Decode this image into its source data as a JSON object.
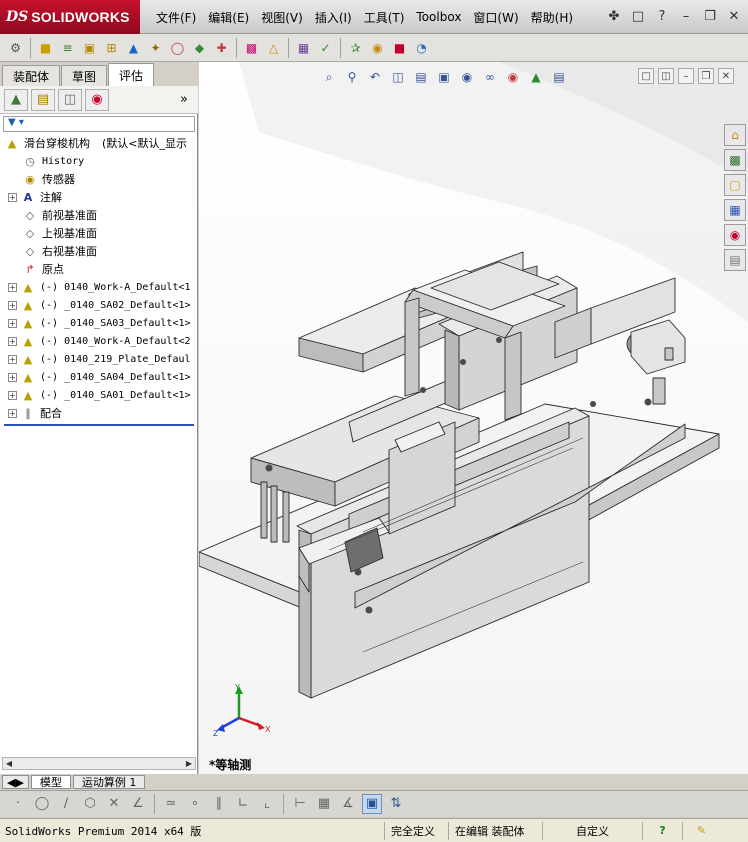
{
  "app": {
    "brand": "SOLIDWORKS",
    "brand_prefix": "DS"
  },
  "menu": [
    "文件(F)",
    "编辑(E)",
    "视图(V)",
    "插入(I)",
    "工具(T)",
    "Toolbox",
    "窗口(W)",
    "帮助(H)"
  ],
  "tabs": {
    "assembly": "装配体",
    "sketch": "草图",
    "evaluate": "评估"
  },
  "tree": {
    "root": "滑台穿梭机构",
    "root_config": "(默认<默认_显示",
    "items": [
      {
        "label": "History",
        "icon": "history-icon",
        "expandable": false
      },
      {
        "label": "传感器",
        "icon": "sensor-icon",
        "expandable": false
      },
      {
        "label": "注解",
        "icon": "annotation-icon",
        "expandable": true
      },
      {
        "label": "前视基准面",
        "icon": "plane-icon",
        "expandable": false
      },
      {
        "label": "上视基准面",
        "icon": "plane-icon",
        "expandable": false
      },
      {
        "label": "右视基准面",
        "icon": "plane-icon",
        "expandable": false
      },
      {
        "label": "原点",
        "icon": "origin-icon",
        "expandable": false
      },
      {
        "label": "(-) 0140_Work-A_Default<1",
        "icon": "subassembly-icon",
        "expandable": true
      },
      {
        "label": "(-) _0140_SA02_Default<1>",
        "icon": "subassembly-icon",
        "expandable": true
      },
      {
        "label": "(-) _0140_SA03_Default<1>",
        "icon": "subassembly-icon",
        "expandable": true
      },
      {
        "label": "(-) 0140_Work-A_Default<2",
        "icon": "subassembly-icon",
        "expandable": true
      },
      {
        "label": "(-) 0140_219_Plate_Defaul",
        "icon": "subassembly-icon",
        "expandable": true
      },
      {
        "label": "(-) _0140_SA04_Default<1>",
        "icon": "subassembly-icon",
        "expandable": true
      },
      {
        "label": "(-) _0140_SA01_Default<1>",
        "icon": "subassembly-icon",
        "expandable": true
      },
      {
        "label": "配合",
        "icon": "mates-icon",
        "expandable": true
      }
    ]
  },
  "bottom_tabs": {
    "model": "模型",
    "motion": "运动算例 1"
  },
  "viewport": {
    "view_name": "*等轴测",
    "background": "#ffffff"
  },
  "triad": {
    "x": "X",
    "y": "Y",
    "z": "Z"
  },
  "status": {
    "product": "SolidWorks Premium 2014 x64 版",
    "definition": "完全定义",
    "editing": "在编辑 装配体",
    "units": "自定义"
  },
  "colors": {
    "brand_red": "#c8102e",
    "axis_x": "#d21e1e",
    "axis_y": "#1e9a1e",
    "axis_z": "#1e3fd2"
  }
}
